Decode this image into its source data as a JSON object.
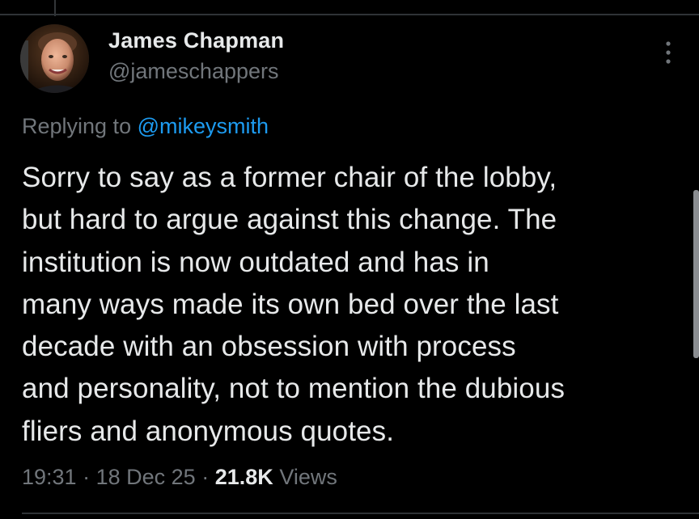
{
  "tweet": {
    "author": {
      "display_name": "James Chapman",
      "handle": "@jameschappers"
    },
    "replying_to": {
      "prefix": "Replying to",
      "mention": "@mikeysmith"
    },
    "text": "Sorry to say as a former chair of the lobby,\nbut hard to argue against this change. The\ninstitution is now outdated and has in\nmany ways made its own bed over the last\ndecade with an obsession with process\nand personality, not to mention the dubious\nfliers and anonymous quotes.",
    "time": "19:31",
    "sep1": "·",
    "date": "18 Dec 25",
    "sep2": "·",
    "views_count": "21.8K",
    "views_label": "Views"
  },
  "icons": {
    "more": "more-vertical-icon",
    "avatar": "profile-photo"
  },
  "colors": {
    "background": "#000000",
    "primary_text": "#e7e9ea",
    "secondary_text": "#71767b",
    "accent": "#1d9bf0",
    "divider": "#2f3336"
  }
}
